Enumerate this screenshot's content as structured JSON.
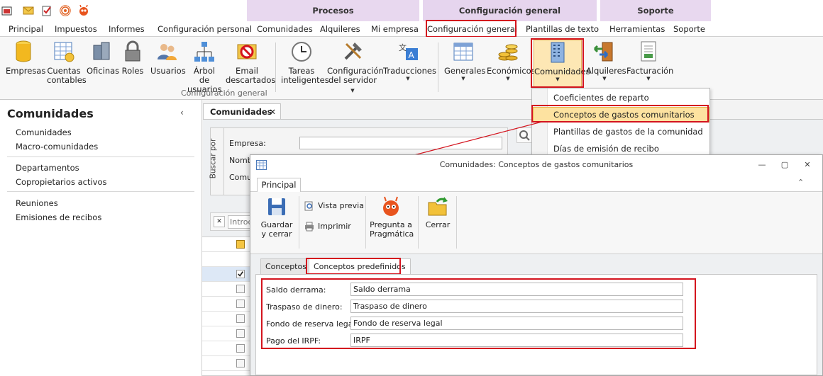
{
  "ribbon_context_groups": {
    "procesos": "Procesos",
    "configuracion_general": "Configuración general",
    "soporte": "Soporte"
  },
  "tabs": [
    "Principal",
    "Impuestos",
    "Informes",
    "Configuración personal",
    "Comunidades",
    "Alquileres",
    "Mi empresa",
    "Configuración general",
    "Plantillas de texto",
    "Herramientas",
    "Soporte"
  ],
  "ribbon": {
    "empresas": "Empresas",
    "cuentas_1": "Cuentas",
    "cuentas_2": "contables",
    "oficinas": "Oficinas",
    "roles": "Roles",
    "usuarios": "Usuarios",
    "arbol_1": "Árbol de",
    "arbol_2": "usuarios",
    "email_1": "Email",
    "email_2": "descartados",
    "tareas_1": "Tareas",
    "tareas_2": "inteligentes",
    "config_serv_1": "Configuración",
    "config_serv_2": "del servidor",
    "traducciones": "Traducciones",
    "generales": "Generales",
    "economicos": "Económicos",
    "comunidades": "Comunidades",
    "alquileres": "Alquileres",
    "facturacion": "Facturación",
    "group_label": "Configuración general"
  },
  "dropdown": {
    "items": [
      "Coeficientes de reparto",
      "Conceptos de gastos comunitarios",
      "Plantillas de gastos de la comunidad",
      "Días de emisión de recibo"
    ]
  },
  "sidebar": {
    "title": "Comunidades",
    "collapse": "‹",
    "items": [
      "Comunidades",
      "Macro-comunidades",
      "Departamentos",
      "Copropietarios activos",
      "Reuniones",
      "Emisiones de recibos"
    ]
  },
  "document": {
    "tab": "Comunidades",
    "close": "✕",
    "search_side": "Buscar por",
    "labels": [
      "Empresa:",
      "Nombr",
      "Comun"
    ],
    "filter_placeholder": "Introd"
  },
  "modal": {
    "title": "Comunidades: Conceptos de gastos comunitarios",
    "tab": "Principal",
    "buttons": {
      "guardar_1": "Guardar",
      "guardar_2": "y cerrar",
      "vista_previa": "Vista previa",
      "imprimir": "Imprimir",
      "pregunta_1": "Pregunta a",
      "pregunta_2": "Pragmática",
      "cerrar": "Cerrar"
    },
    "inner_tabs": {
      "conceptos": "Conceptos",
      "predefinidos": "Conceptos predefinidos"
    },
    "fields": [
      {
        "label": "Saldo derrama:",
        "value": "Saldo derrama"
      },
      {
        "label": "Traspaso de dinero:",
        "value": "Traspaso de dinero"
      },
      {
        "label": "Fondo de reserva legal:",
        "value": "Fondo de reserva legal"
      },
      {
        "label": "Pago del IRPF:",
        "value": "IRPF"
      }
    ]
  },
  "colors": {
    "highlight_red": "#d4141e",
    "context_tab": "#e8d8ef",
    "menu_highlight": "#fde2a0"
  }
}
